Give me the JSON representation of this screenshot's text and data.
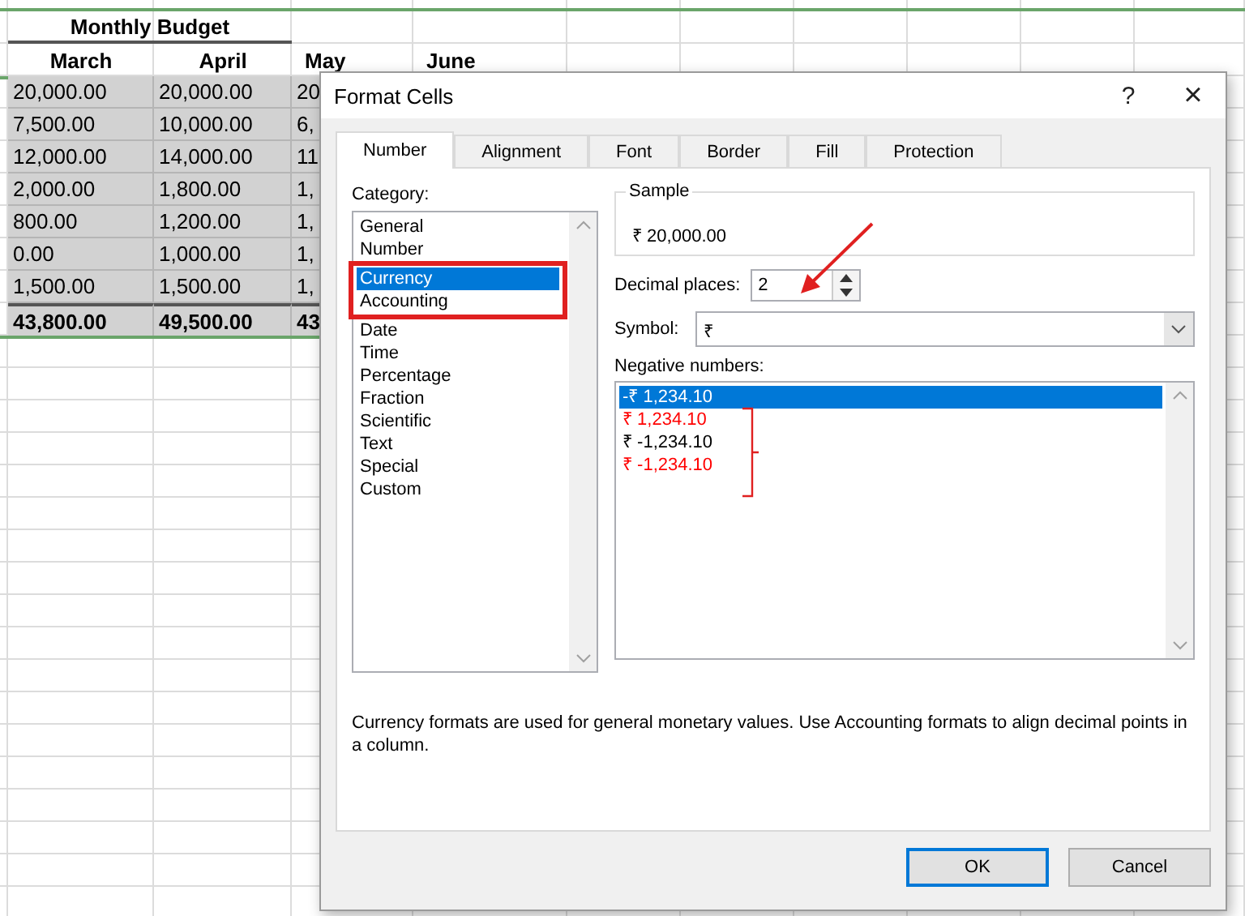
{
  "sheet": {
    "title": "Monthly Budget",
    "headers": [
      "March",
      "April",
      "May",
      "June"
    ],
    "rows": [
      [
        "20,000.00",
        "20,000.00",
        "20"
      ],
      [
        "7,500.00",
        "10,000.00",
        "6,"
      ],
      [
        "12,000.00",
        "14,000.00",
        "11"
      ],
      [
        "2,000.00",
        "1,800.00",
        "1,"
      ],
      [
        "800.00",
        "1,200.00",
        "1,"
      ],
      [
        "0.00",
        "1,000.00",
        "1,"
      ],
      [
        "1,500.00",
        "1,500.00",
        "1,"
      ]
    ],
    "total": [
      "43,800.00",
      "49,500.00",
      "43"
    ]
  },
  "dialog": {
    "title": "Format Cells",
    "help": "?",
    "close": "×",
    "tabs": [
      {
        "label": "Number",
        "selected": true
      },
      {
        "label": "Alignment",
        "selected": false
      },
      {
        "label": "Font",
        "selected": false
      },
      {
        "label": "Border",
        "selected": false
      },
      {
        "label": "Fill",
        "selected": false
      },
      {
        "label": "Protection",
        "selected": false
      }
    ],
    "category_label": "Category:",
    "categories": [
      {
        "label": "General",
        "selected": false
      },
      {
        "label": "Number",
        "selected": false
      },
      {
        "label": "Currency",
        "selected": true
      },
      {
        "label": "Accounting",
        "selected": false
      },
      {
        "label": "Date",
        "selected": false
      },
      {
        "label": "Time",
        "selected": false
      },
      {
        "label": "Percentage",
        "selected": false
      },
      {
        "label": "Fraction",
        "selected": false
      },
      {
        "label": "Scientific",
        "selected": false
      },
      {
        "label": "Text",
        "selected": false
      },
      {
        "label": "Special",
        "selected": false
      },
      {
        "label": "Custom",
        "selected": false
      }
    ],
    "sample_label": "Sample",
    "sample_value": "₹ 20,000.00",
    "decimal_label": "Decimal places:",
    "decimal_value": "2",
    "symbol_label": "Symbol:",
    "symbol_value": "₹",
    "negative_label": "Negative numbers:",
    "negatives": [
      {
        "label": "-₹ 1,234.10",
        "selected": true
      },
      {
        "label": "₹ 1,234.10",
        "color": "#ff0000",
        "selected": false
      },
      {
        "label": "₹ -1,234.10",
        "color": "#000000",
        "selected": false
      },
      {
        "label": "₹ -1,234.10",
        "color": "#ff0000",
        "selected": false
      }
    ],
    "description": "Currency formats are used for general monetary values.  Use Accounting formats to align decimal points in a column.",
    "buttons": [
      {
        "label": "OK",
        "kind": "default"
      },
      {
        "label": "Cancel",
        "kind": "normal"
      }
    ]
  }
}
